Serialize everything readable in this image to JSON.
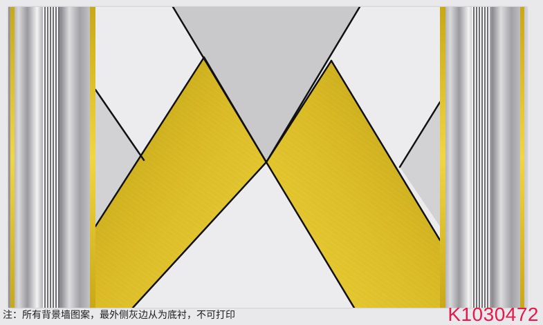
{
  "note": "注：所有背景墙图案，最外侧灰边从为底衬，不可打印",
  "product_code": "K1030472",
  "colors": {
    "gold": "#e2c52a",
    "gold_dark": "#b99a12",
    "light_gray": "#ececee",
    "mid_gray": "#c9c9cb",
    "line": "#111111",
    "code_red": "#e6194b"
  }
}
